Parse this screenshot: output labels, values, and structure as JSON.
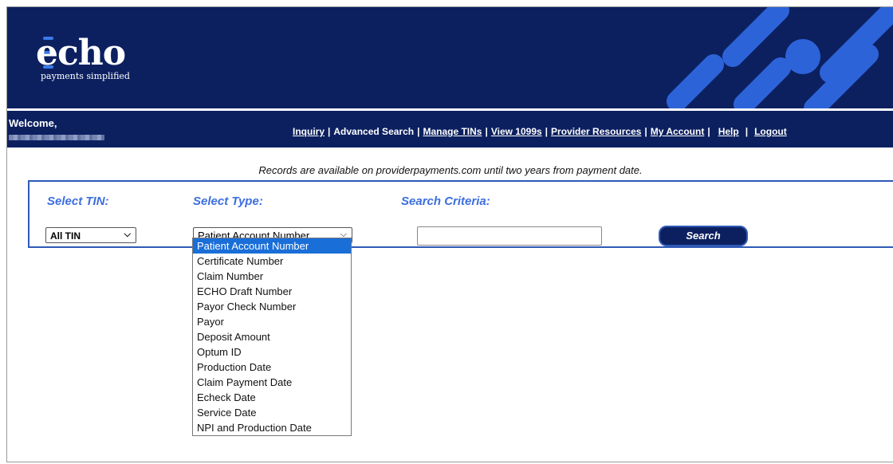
{
  "brand": {
    "name": "echo",
    "tagline": "payments simplified"
  },
  "welcome": {
    "label": "Welcome,"
  },
  "nav": {
    "items": [
      {
        "label": "Inquiry",
        "link": true
      },
      {
        "label": "Advanced Search",
        "link": false
      },
      {
        "label": "Manage TINs",
        "link": true
      },
      {
        "label": "View 1099s",
        "link": true
      },
      {
        "label": "Provider Resources",
        "link": true
      },
      {
        "label": "My Account",
        "link": true
      },
      {
        "label": "Help",
        "link": true
      },
      {
        "label": "Logout",
        "link": true
      }
    ]
  },
  "notice": "Records are available on providerpayments.com until two years from payment date.",
  "form": {
    "tin_label": "Select TIN:",
    "type_label": "Select Type:",
    "criteria_label": "Search Criteria:",
    "tin_value": "All TIN",
    "type_value": "Patient Account Number",
    "criteria_value": "",
    "search_label": "Search"
  },
  "dropdown": {
    "options": [
      "Patient Account Number",
      "Certificate Number",
      "Claim Number",
      "ECHO Draft Number",
      "Payor Check Number",
      "Payor",
      "Deposit Amount",
      "Optum ID",
      "Production Date",
      "Claim Payment Date",
      "Echeck Date",
      "Service Date",
      "NPI and Production Date"
    ],
    "selected": "Patient Account Number"
  },
  "colors": {
    "header": "#0c2060",
    "accent": "#3c6ee0",
    "highlight": "#1a6ed8",
    "deco": "#2d63d8"
  }
}
